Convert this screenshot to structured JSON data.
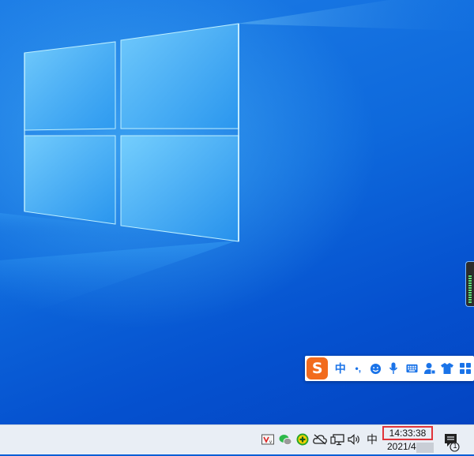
{
  "desktop": {
    "wallpaper": "windows-10-light-beam",
    "accent": "#0a5fd6",
    "gadget": "audio-level-gadget"
  },
  "ime_toolbar": {
    "logo_letter": "S",
    "logo_color": "#f26b1d",
    "mode_label": "中",
    "punctuation_label": "•,",
    "icons": [
      "emoji-icon",
      "microphone-icon",
      "keyboard-icon",
      "user-icon",
      "skin-shirt-icon",
      "toolbox-grid-icon"
    ],
    "icon_color": "#1a73e8"
  },
  "taskbar": {
    "tray_icons": [
      "vpn-shield-icon",
      "wechat-icon",
      "security-plus-icon",
      "onedrive-offline-icon",
      "network-monitor-icon",
      "volume-icon",
      "ime-indicator"
    ],
    "ime_indicator_label": "中",
    "clock": {
      "time": "14:33:38",
      "date": "2021/4"
    },
    "notifications": {
      "count": "1"
    },
    "highlight_color": "#e0343a"
  }
}
